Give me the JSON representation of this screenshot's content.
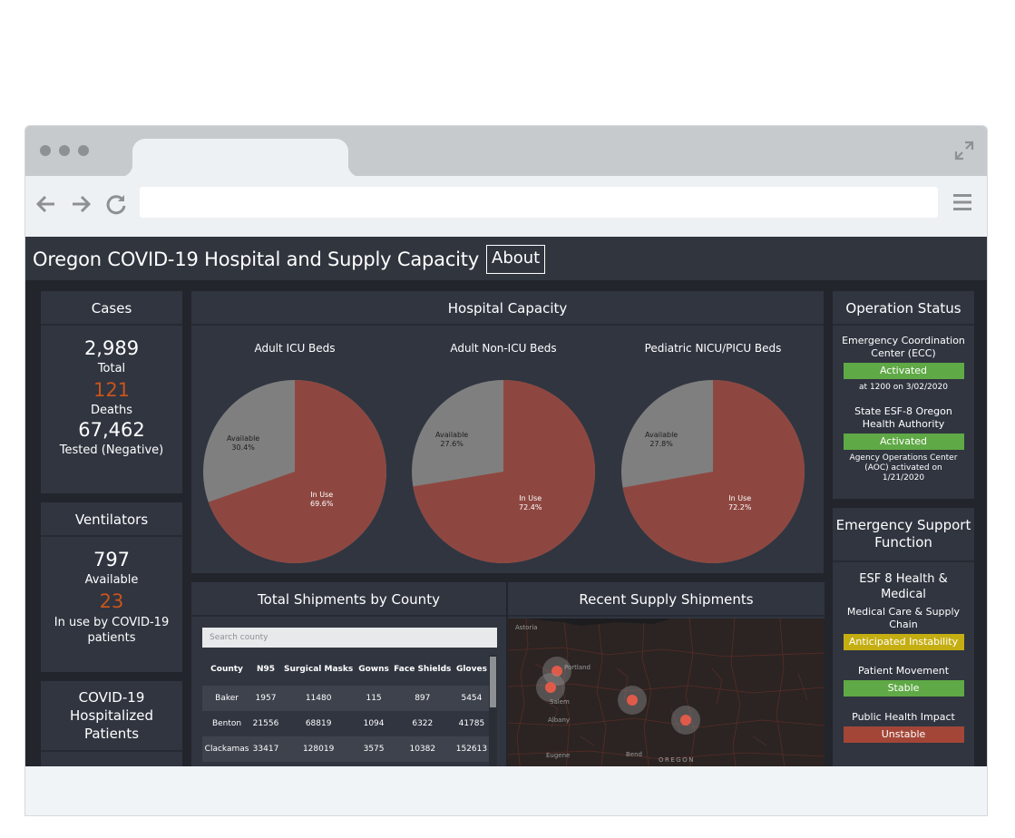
{
  "app": {
    "title": "Oregon COVID-19 Hospital and Supply Capacity",
    "about_label": "About"
  },
  "cases": {
    "header": "Cases",
    "total_value": "2,989",
    "total_label": "Total",
    "deaths_value": "121",
    "deaths_label": "Deaths",
    "tested_value": "67,462",
    "tested_label": "Tested (Negative)"
  },
  "ventilators": {
    "header": "Ventilators",
    "available_value": "797",
    "available_label": "Available",
    "in_use_value": "23",
    "in_use_label": "In use by COVID-19 patients"
  },
  "hospitalized": {
    "header": "COVID-19 Hospitalized Patients"
  },
  "hospital_capacity": {
    "header": "Hospital Capacity",
    "colors": {
      "in_use": "#8e4740",
      "available": "#7f7f7f"
    },
    "charts": [
      {
        "title": "Adult ICU Beds",
        "available_label": "Available",
        "available_value": "30.4%",
        "in_use_label": "In Use",
        "in_use_value": "69.6%",
        "in_use_fraction": 0.696
      },
      {
        "title": "Adult Non-ICU Beds",
        "available_label": "Available",
        "available_value": "27.6%",
        "in_use_label": "In Use",
        "in_use_value": "72.4%",
        "in_use_fraction": 0.724
      },
      {
        "title": "Pediatric NICU/PICU Beds",
        "available_label": "Available",
        "available_value": "27.8%",
        "in_use_label": "In Use",
        "in_use_value": "72.2%",
        "in_use_fraction": 0.722
      }
    ]
  },
  "shipments": {
    "header": "Total Shipments by County",
    "search_placeholder": "Search county",
    "columns": [
      "County",
      "N95",
      "Surgical Masks",
      "Gowns",
      "Face Shields",
      "Gloves"
    ],
    "rows": [
      [
        "Baker",
        "1957",
        "11480",
        "115",
        "897",
        "5454"
      ],
      [
        "Benton",
        "21556",
        "68819",
        "1094",
        "6322",
        "41785"
      ],
      [
        "Clackamas",
        "33417",
        "128019",
        "3575",
        "10382",
        "152613"
      ]
    ]
  },
  "recent_shipments": {
    "header": "Recent Supply Shipments",
    "map_labels": [
      "Astoria",
      "Portland",
      "Salem",
      "Albany",
      "Eugene",
      "Bend",
      "OREGON"
    ]
  },
  "operation_status": {
    "header": "Operation Status",
    "ecc_title": "Emergency Coordination Center (ECC)",
    "ecc_status": "Activated",
    "ecc_note": "at 1200 on 3/02/2020",
    "esf8_title": "State ESF-8 Oregon Health Authority",
    "esf8_status": "Activated",
    "esf8_note": "Agency Operations Center (AOC) activated on 1/21/2020"
  },
  "esf": {
    "header": "Emergency Support Function",
    "subheader": "ESF 8 Health & Medical",
    "items": [
      {
        "label": "Medical Care & Supply Chain",
        "status": "Anticipated Instability"
      },
      {
        "label": "Patient Movement",
        "status": "Stable"
      },
      {
        "label": "Public Health Impact",
        "status": "Unstable"
      }
    ]
  }
}
